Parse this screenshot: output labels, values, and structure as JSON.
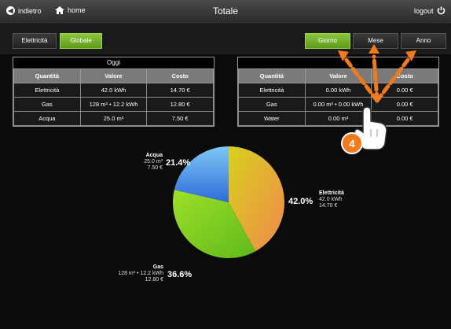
{
  "header": {
    "back_label": "indietro",
    "home_label": "home",
    "title": "Totale",
    "logout_label": "logout"
  },
  "tabs": {
    "elettricita": "Elettricità",
    "globale": "Globale"
  },
  "periods": {
    "giorno": "Giorno",
    "mese": "Mese",
    "anno": "Anno",
    "active": "Giorno"
  },
  "table_left": {
    "title": "Oggi",
    "columns": [
      "Quantità",
      "Valore",
      "Costo"
    ],
    "rows": [
      [
        "Elettricità",
        "42.0 kWh",
        "14.70 €"
      ],
      [
        "Gas",
        "128 m³ • 12.2 kWh",
        "12.80 €"
      ],
      [
        "Acqua",
        "25.0 m³",
        "7.50 €"
      ]
    ]
  },
  "table_right": {
    "title": "",
    "columns": [
      "Quantità",
      "Valore",
      "Costo"
    ],
    "rows": [
      [
        "Elettricità",
        "0.00 kWh",
        "0.00 €"
      ],
      [
        "Gas",
        "0.00 m³ • 0.00 kWh",
        "0.00 €"
      ],
      [
        "Water",
        "0.00 m³",
        "0.00 €"
      ]
    ]
  },
  "step_badge": "4",
  "chart_data": {
    "type": "pie",
    "slices": [
      {
        "name": "Elettricità",
        "percent": 42.0,
        "value": "42.0 kWh",
        "cost": "14.70 €",
        "color": "#e9a24a"
      },
      {
        "name": "Gas",
        "percent": 36.6,
        "value": "128 m³ • 12.2 kWh",
        "cost": "12.80 €",
        "color": "#7fcc2a"
      },
      {
        "name": "Acqua",
        "percent": 21.4,
        "value": "25.0 m³",
        "cost": "7.50 €",
        "color": "#3b7fe0"
      }
    ],
    "labels": {
      "elettricita_pct": "42.0%",
      "gas_pct": "36.6%",
      "acqua_pct": "21.4%"
    }
  },
  "colors": {
    "accent_green": "#8cc63f",
    "arrow_orange": "#f07a1e"
  }
}
